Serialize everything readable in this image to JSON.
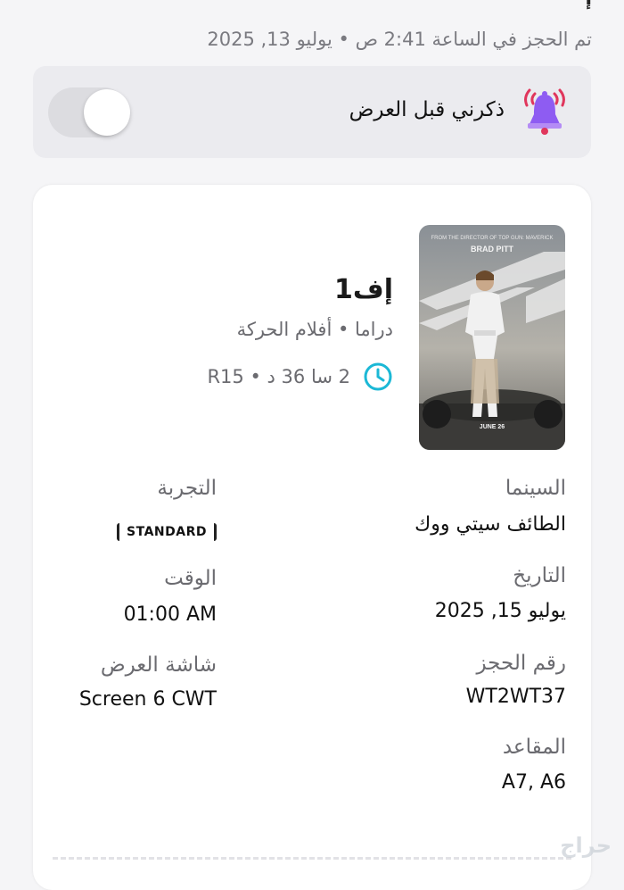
{
  "header": {
    "top_fragment": "إ",
    "booked_text": "تم الحجز في الساعة 2:41 ص • يوليو 13, 2025"
  },
  "reminder": {
    "label": "ذكرني قبل العرض",
    "enabled": false,
    "icon": "bell-ringing-icon"
  },
  "movie": {
    "title": "إف1",
    "genres": "دراما • أفلام الحركة",
    "duration_rating": "2 سا 36 د • R15",
    "poster_actor_text": "BRAD PITT",
    "poster_date_text": "JUNE 26"
  },
  "details": {
    "cinema_label": "السينما",
    "cinema_value": "الطائف سيتي ووك",
    "experience_label": "التجربة",
    "experience_value": "STANDARD",
    "date_label": "التاريخ",
    "date_value": "يوليو 15, 2025",
    "time_label": "الوقت",
    "time_value": "01:00 AM",
    "booking_label": "رقم الحجز",
    "booking_value": "WT2WT37",
    "screen_label": "شاشة العرض",
    "screen_value": "Screen 6 CWT",
    "seats_label": "المقاعد",
    "seats_value": "A7, A6"
  },
  "watermark": "حراج",
  "colors": {
    "accent_clock": "#1bb8d6",
    "bell_body": "#8e5cf2",
    "bell_wave": "#e0365c",
    "toggle_off": "#dcdce0"
  }
}
